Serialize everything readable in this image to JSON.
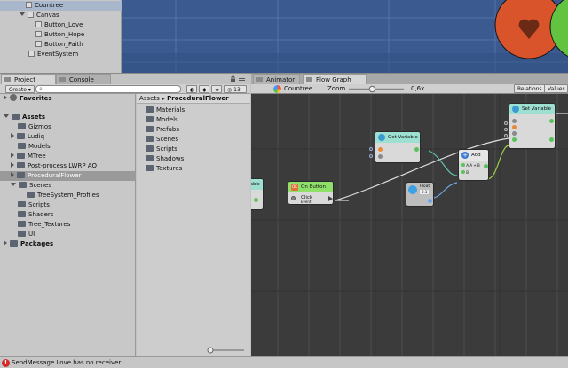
{
  "hierarchy": {
    "items": [
      {
        "label": "Countree",
        "selected": true
      },
      {
        "label": "Canvas"
      },
      {
        "label": "Button_Love"
      },
      {
        "label": "Button_Hope"
      },
      {
        "label": "Button_Faith"
      },
      {
        "label": "EventSystem"
      }
    ]
  },
  "project_panel": {
    "tabs": [
      "Project",
      "Console"
    ],
    "create_label": "Create",
    "hidden_count": "13",
    "tree": {
      "favorites_label": "Favorites",
      "assets_label": "Assets",
      "folders": [
        "Gizmos",
        "Ludiq",
        "Models",
        "MTree",
        "Post-process LWRP AO",
        "ProceduralFlower",
        "Scenes",
        "TreeSystem_Profiles",
        "Scripts",
        "Shaders",
        "Tree_Textures",
        "UI"
      ],
      "packages_label": "Packages"
    },
    "content": {
      "breadcrumb_root": "Assets",
      "breadcrumb_separator": "►",
      "breadcrumb_current": "ProceduralFlower",
      "items": [
        "Materials",
        "Models",
        "Prefabs",
        "Scenes",
        "Scripts",
        "Shadows",
        "Textures"
      ]
    }
  },
  "graph_panel": {
    "tabs": [
      "Animator",
      "Flow Graph"
    ],
    "graph_name": "Countree",
    "zoom_label": "Zoom",
    "zoom_value": "0,6x",
    "zoom_level": 0.42,
    "relations_label": "Relations",
    "values_label": "Values",
    "nodes": {
      "partial_left": "able",
      "on_button_click": {
        "title": "On Button Click",
        "subtitle": "Event"
      },
      "get_variable": {
        "title": "Get Variable"
      },
      "add": {
        "title": "Add",
        "port_label": "A + B",
        "port_a": "A",
        "port_b": "B"
      },
      "float": {
        "title": "Float",
        "value": "0.1"
      },
      "set_variable": {
        "title": "Set Variable"
      }
    }
  },
  "status_bar": {
    "message": "SendMessage Love has no receiver!"
  },
  "colors": {
    "scene_bg": "#3a5a90",
    "event_node": "#8ee06a",
    "variable_node": "#9de0d2",
    "error": "#d62a2a"
  }
}
